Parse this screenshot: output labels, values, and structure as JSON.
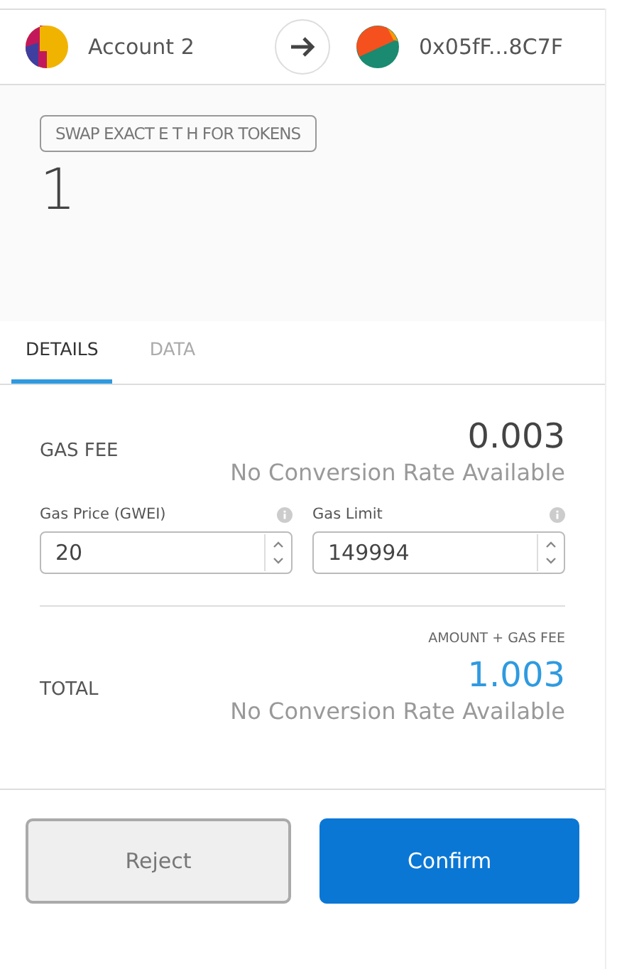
{
  "header": {
    "from_account": "Account 2",
    "to_account": "0x05fF...8C7F"
  },
  "method_badge": "SWAP EXACT E T H FOR TOKENS",
  "amount": "1",
  "tabs": [
    {
      "label": "DETAILS",
      "selected": true
    },
    {
      "label": "DATA",
      "selected": false
    }
  ],
  "gas_fee": {
    "label": "GAS FEE",
    "value": "0.003",
    "conversion": "No Conversion Rate Available"
  },
  "gas_fields": [
    {
      "label": "Gas Price (GWEI)",
      "value": "20"
    },
    {
      "label": "Gas Limit",
      "value": "149994"
    }
  ],
  "total": {
    "caption": "AMOUNT + GAS FEE",
    "label": "TOTAL",
    "value": "1.003",
    "conversion": "No Conversion Rate Available"
  },
  "buttons": [
    {
      "label": "Reject",
      "kind": "secondary"
    },
    {
      "label": "Confirm",
      "kind": "primary"
    }
  ]
}
